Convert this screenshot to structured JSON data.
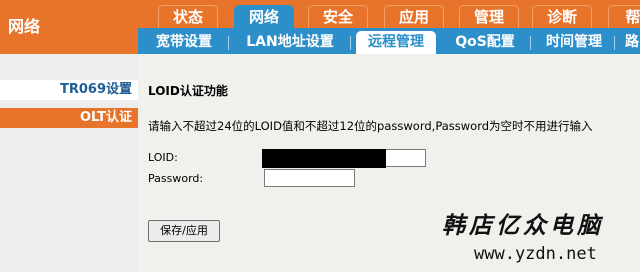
{
  "header": {
    "section_title": "网络",
    "main_tabs": [
      "状态",
      "网络",
      "安全",
      "应用",
      "管理",
      "诊断",
      "帮"
    ],
    "active_main_tab": "网络",
    "sub_tabs": [
      "宽带设置",
      "LAN地址设置",
      "远程管理",
      "QoS配置",
      "时间管理",
      "路"
    ],
    "active_sub_tab": "远程管理"
  },
  "sidebar": {
    "items": [
      {
        "label": "TR069设置"
      },
      {
        "label": "OLT认证"
      }
    ],
    "active_item": "OLT认证"
  },
  "content": {
    "title": "LOID认证功能",
    "description": "请输入不超过24位的LOID值和不超过12位的password,Password为空时不用进行输入",
    "loid_label": "LOID:",
    "loid_value": "",
    "password_label": "Password:",
    "password_value": "",
    "save_button": "保存/应用"
  },
  "watermark": {
    "name": "韩店亿众电脑",
    "url": "www.yzdn.net"
  },
  "colors": {
    "orange": "#e8732b",
    "blue": "#2d8fc9",
    "content_bg": "#f0f0ec"
  }
}
